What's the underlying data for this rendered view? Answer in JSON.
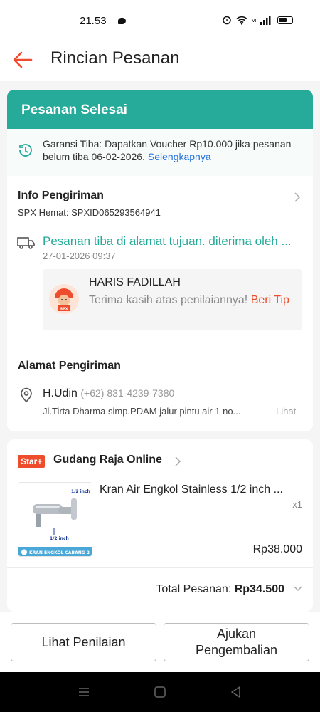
{
  "status_bar": {
    "time": "21.53",
    "right_icons": "⏰ ◔ ▮▮▮"
  },
  "header": {
    "title": "Rincian Pesanan"
  },
  "order": {
    "status": "Pesanan Selesai",
    "guarantee_text": "Garansi Tiba: Dapatkan Voucher Rp10.000 jika pesanan belum tiba 06-02-2026.",
    "guarantee_link": "Selengkapnya"
  },
  "shipping": {
    "title": "Info Pengiriman",
    "courier_service": "SPX Hemat: SPXID065293564941",
    "tracking_status": "Pesanan tiba di alamat tujuan. diterima oleh ...",
    "tracking_time": "27-01-2026 09:37",
    "courier_name": "HARIS FADILLAH",
    "courier_message": "Terima kasih atas penilaiannya!",
    "tip_label": "Beri Tip"
  },
  "address": {
    "title": "Alamat Pengiriman",
    "name": "H.Udin",
    "phone": "(+62) 831-4239-7380",
    "line": "Jl.Tirta Dharma simp.PDAM jalur pintu air 1 no...",
    "more_link": "Lihat"
  },
  "shop": {
    "badge": "Star+",
    "name": "Gudang Raja Online",
    "product_name": "Kran Air Engkol Stainless 1/2 inch ...",
    "quantity": "x1",
    "price": "Rp38.000",
    "thumb_label_top": "1/2 inch",
    "thumb_label_bottom": "1/2 inch",
    "thumb_caption": "KRAN ENGKOL CABANG 2",
    "total_label": "Total Pesanan:",
    "total_value": "Rp34.500"
  },
  "actions": {
    "review_button": "Lihat Penilaian",
    "return_button": "Ajukan Pengembalian"
  },
  "colors": {
    "primary_green": "#26aa99",
    "shopee_orange": "#ee4d2d",
    "link_blue": "#2673dd"
  }
}
